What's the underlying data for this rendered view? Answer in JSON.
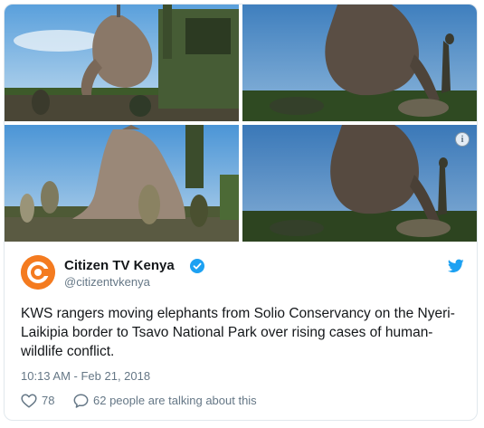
{
  "tweet": {
    "display_name": "Citizen TV Kenya",
    "handle": "@citizentvkenya",
    "text": "KWS rangers moving elephants from Solio Conservancy on the Nyeri-Laikipia border to Tsavo National Park over rising cases of human-wildlife conflict.",
    "timestamp": "10:13 AM - Feb 21, 2018",
    "like_count": "78",
    "talking": "62 people are talking about this",
    "verified": true
  },
  "media": {
    "count": 4,
    "info_glyph": "i"
  },
  "colors": {
    "twitter_blue": "#1da1f2",
    "secondary_text": "#657786",
    "brand_orange": "#f47b20"
  },
  "icons": {
    "info": "info-icon",
    "verified": "verified-badge-icon",
    "bird": "twitter-bird-icon",
    "heart": "heart-icon",
    "reply": "reply-bubble-icon"
  }
}
